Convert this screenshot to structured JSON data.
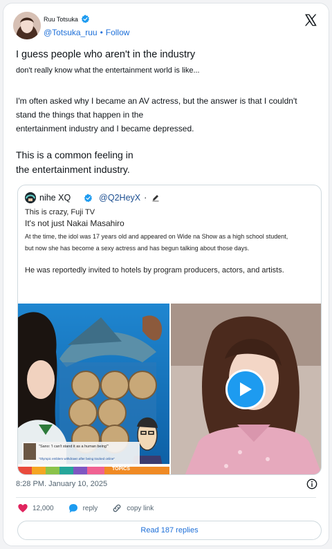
{
  "post": {
    "display_name": "Ruu Totsuka",
    "handle": "@Totsuka_ruu",
    "follow_sep": "•",
    "follow_label": "Follow",
    "text_line1": "I guess people who aren't in the industry",
    "text_line2": "don't really know what the entertainment world is like...",
    "text_para2_l1": "I'm often asked why I became an AV actress, but the answer is that I couldn't",
    "text_para2_l2": "stand the things that happen in the",
    "text_para2_l3": "entertainment industry and I became depressed.",
    "text_para3_l1": "This is a common feeling in",
    "text_para3_l2": "the entertainment industry.",
    "timestamp": "8:28 PM. January 10, 2025"
  },
  "quote": {
    "display_name": "nihe XQ",
    "handle": "@Q2HeyX",
    "sep": "·",
    "line1": "This is crazy, Fuji TV",
    "line2": "It's not just Nakai Masahiro",
    "line3": "At the time, the idol was 17 years old and appeared on Wide na Show as a high school student,",
    "line4": "but now she has become a sexy actress and has begun talking about those days.",
    "line5": "He was reportedly invited to hotels by program producers, actors, and artists."
  },
  "media_left": {
    "caption1": "\"Sano: 'I can't stand it as a human being'\"",
    "caption2": "\"Olympic emblem withdrawn after being tracked online\"",
    "tag": "TOPICS"
  },
  "actions": {
    "likes": "12,000",
    "reply_label": "reply",
    "copy_label": "copy link",
    "read_replies": "Read 187 replies"
  },
  "colors": {
    "accent": "#1d9bf0",
    "link": "#1d6fd8",
    "like": "#e0245e"
  }
}
